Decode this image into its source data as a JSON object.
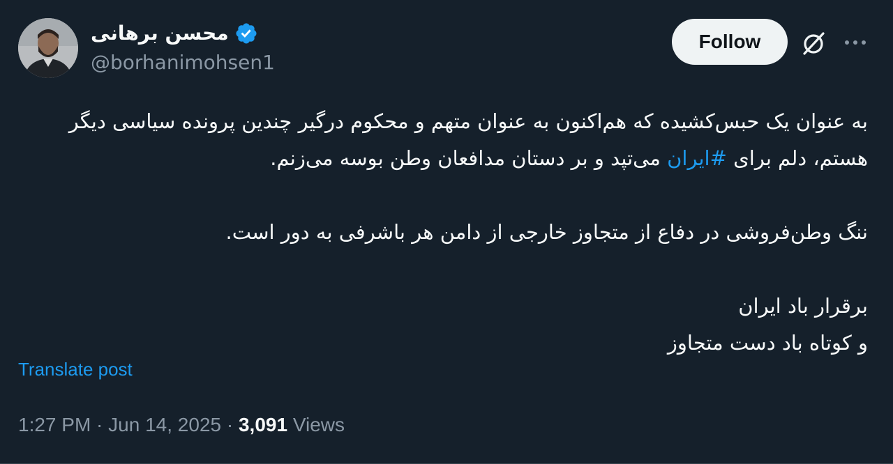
{
  "author": {
    "display_name": "محسن برهانی",
    "handle": "@borhanimohsen1",
    "verified_icon": "verified-badge-icon"
  },
  "header": {
    "follow_label": "Follow",
    "grok_icon": "grok-icon",
    "more_icon": "more-options-icon"
  },
  "tweet": {
    "para1_part1": "به عنوان یک حبس‌کشیده که هم‌اکنون به عنوان متهم و محکوم درگیر چندین پرونده سیاسی دیگر هستم، دلم برای ",
    "hashtag": "#ایران",
    "para1_part2": " می‌تپد و بر دستان مدافعان وطن بوسه می‌زنم.",
    "para2": "ننگ وطن‌فروشی در دفاع از متجاوز خارجی از دامن هر باشرفی به دور است.",
    "para3_line1": "برقرار باد ایران",
    "para3_line2": "و کوتاه باد دست متجاوز"
  },
  "translate_label": "Translate post",
  "meta": {
    "time": "1:27 PM",
    "separator": " · ",
    "date": "Jun 14, 2025",
    "views_count": "3,091",
    "views_label": "Views"
  },
  "colors": {
    "background": "#15202b",
    "accent": "#1d9bf0",
    "text_primary": "#f7f9f9",
    "text_secondary": "#8b98a5"
  }
}
